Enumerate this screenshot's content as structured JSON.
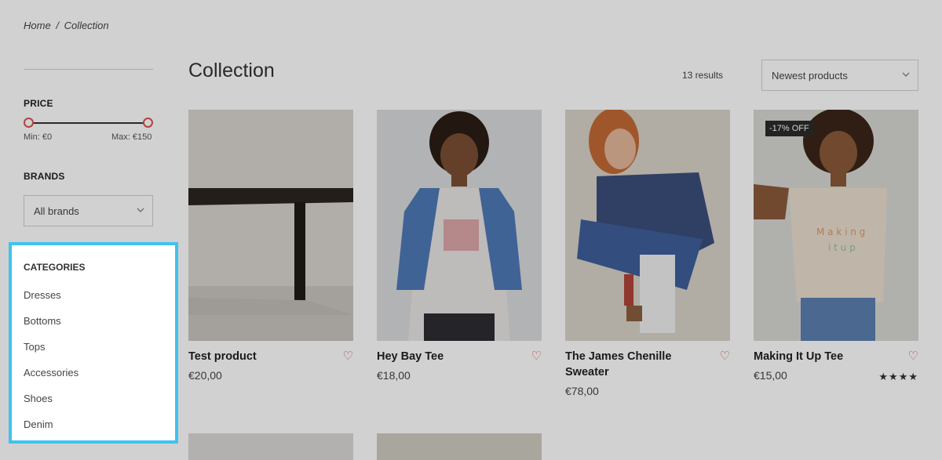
{
  "breadcrumb": {
    "home": "Home",
    "separator": "/",
    "current": "Collection"
  },
  "filters": {
    "price": {
      "title": "PRICE",
      "min_label": "Min: €0",
      "max_label": "Max: €150",
      "min": 0,
      "max": 150
    },
    "brands": {
      "title": "BRANDS",
      "selected": "All brands"
    },
    "categories": {
      "title": "CATEGORIES",
      "items": [
        "Dresses",
        "Bottoms",
        "Tops",
        "Accessories",
        "Shoes",
        "Denim"
      ]
    }
  },
  "main": {
    "title": "Collection",
    "results": "13 results",
    "sort": {
      "selected": "Newest products"
    }
  },
  "products": [
    {
      "name": "Test product",
      "price": "€20,00",
      "badge": "",
      "rating": 0,
      "image_icon": "table-image"
    },
    {
      "name": "Hey Bay Tee",
      "price": "€18,00",
      "badge": "",
      "rating": 0,
      "image_icon": "raglan-tee-image"
    },
    {
      "name": "The James Chenille Sweater",
      "price": "€78,00",
      "badge": "",
      "rating": 0,
      "image_icon": "sweater-image"
    },
    {
      "name": "Making It Up Tee",
      "price": "€15,00",
      "badge": "-17% OFF",
      "rating": 4,
      "image_icon": "tee-image"
    }
  ],
  "colors": {
    "accent": "#3fc3ee",
    "heart": "#d9534f",
    "overlay": "rgba(0,0,0,0.18)"
  },
  "icons": {
    "chevron": "chevron-down-icon",
    "heart": "heart-icon",
    "star": "star-icon"
  }
}
